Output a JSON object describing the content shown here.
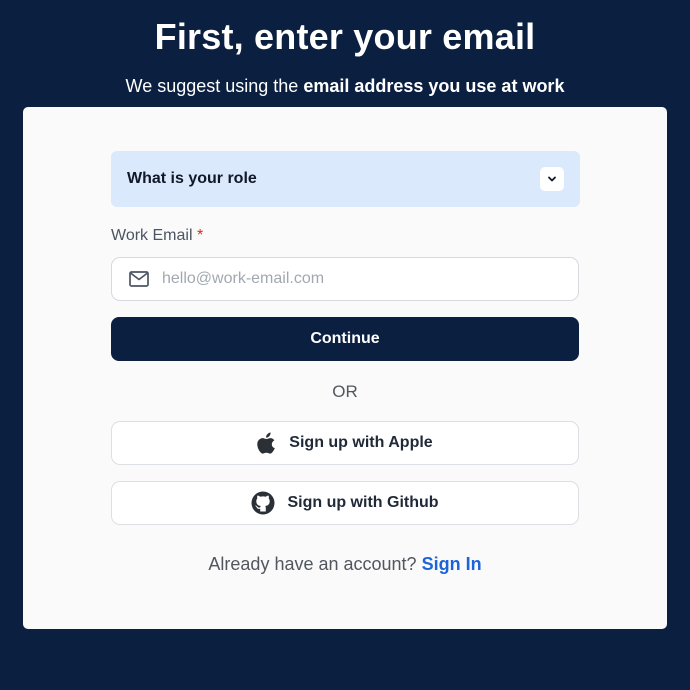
{
  "header": {
    "title": "First, enter your email",
    "subtitle_prefix": "We suggest using the",
    "subtitle_emphasis": "email address you use at work"
  },
  "form": {
    "role_select": {
      "label": "What is your role",
      "icon": "chevron-down-icon"
    },
    "email": {
      "label": "Work Email",
      "required_marker": "*",
      "placeholder": "hello@work-email.com",
      "value": "",
      "icon": "mail-icon"
    },
    "continue_label": "Continue",
    "divider_text": "OR",
    "social": {
      "apple_label": "Sign up with Apple",
      "apple_icon": "apple-icon",
      "github_label": "Sign up with Github",
      "github_icon": "github-icon"
    },
    "signin": {
      "prompt": "Already have an account?",
      "link_label": "Sign In"
    }
  },
  "colors": {
    "background": "#0b2040",
    "card": "#fafafa",
    "select_bg": "#dbe9fd",
    "primary_button": "#0b2040",
    "link": "#1d64d8",
    "required": "#dc2626"
  }
}
